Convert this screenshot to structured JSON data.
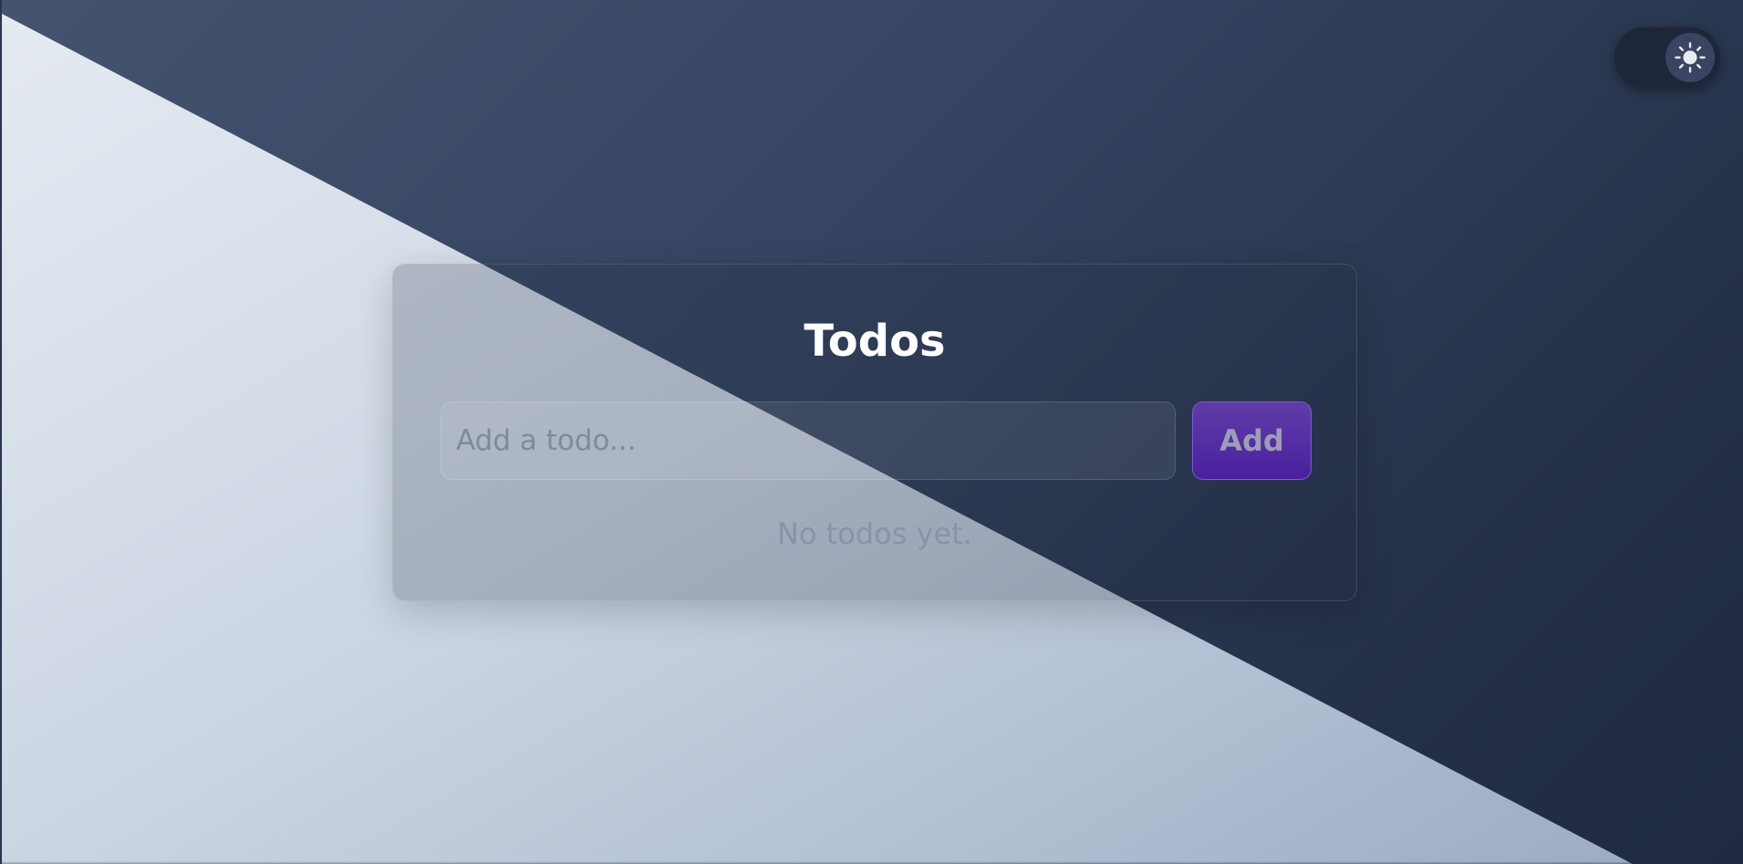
{
  "theme_toggle": {
    "icon": "sun-icon"
  },
  "card": {
    "title": "Todos",
    "input": {
      "placeholder": "Add a todo...",
      "value": ""
    },
    "add_button_label": "Add",
    "empty_message": "No todos yet."
  },
  "colors": {
    "accent": "#4a1f9e",
    "background_dark": "#2a3650",
    "background_light": "#dfe6ef"
  }
}
